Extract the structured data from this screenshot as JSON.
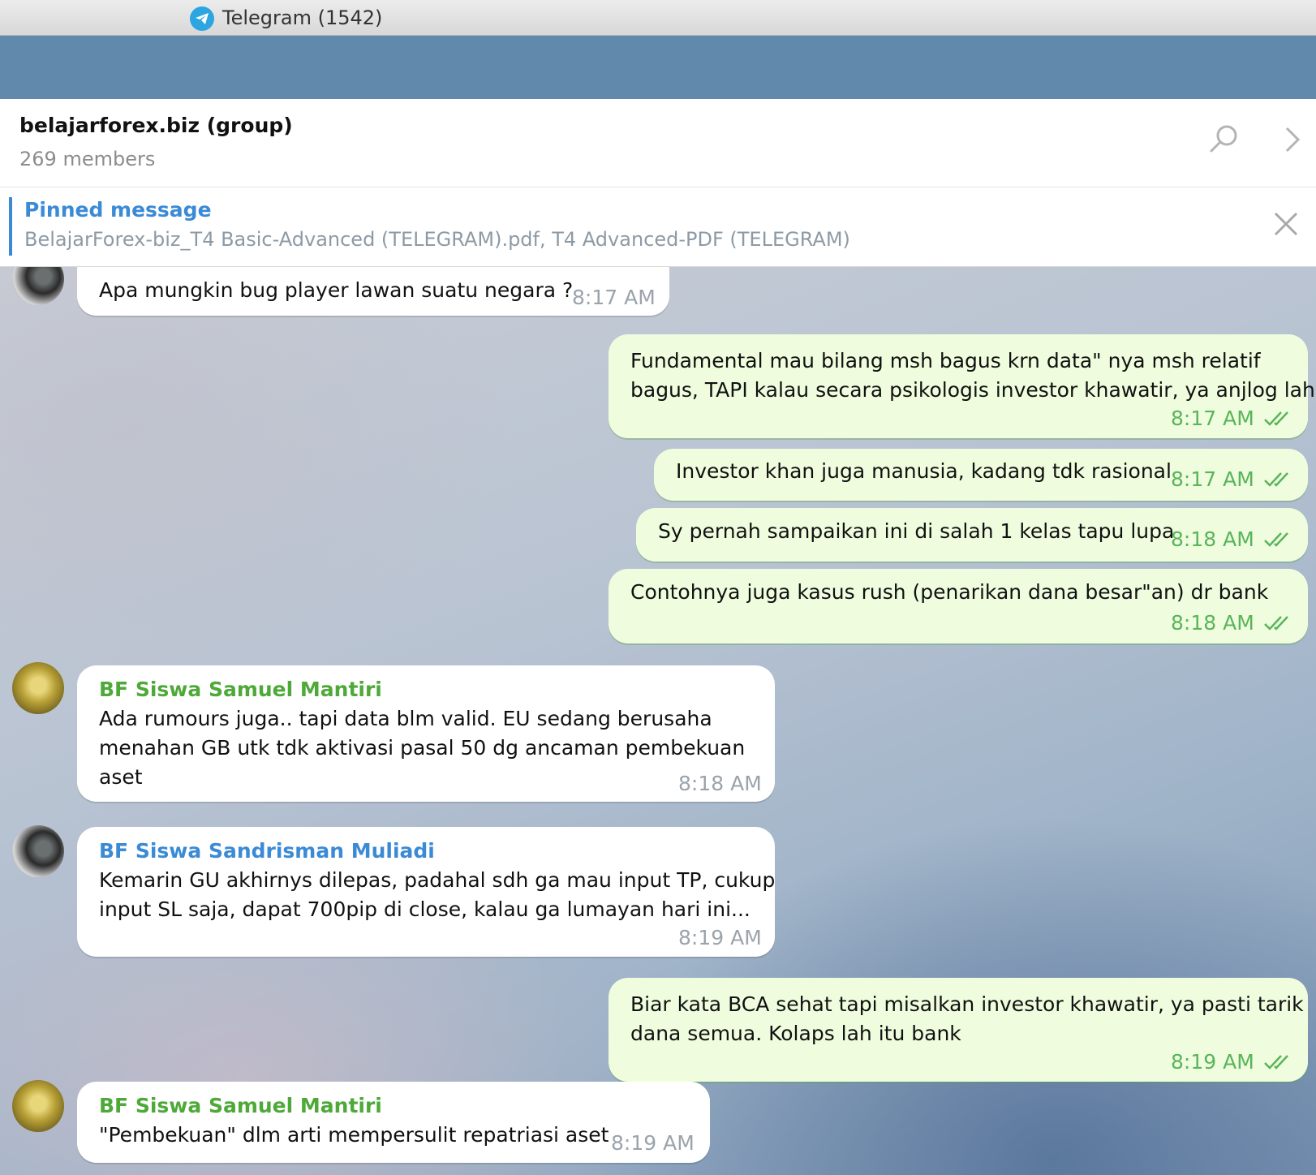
{
  "window": {
    "title": "Telegram (1542)"
  },
  "header": {
    "chat_title": "belajarforex.biz (group)",
    "members": "269 members"
  },
  "pinned": {
    "label": "Pinned message",
    "text": "BelajarForex-biz_T4 Basic-Advanced (TELEGRAM).pdf, T4 Advanced-PDF (TELEGRAM)"
  },
  "messages": [
    {
      "direction": "in",
      "sender": "",
      "lines": [
        "Apa mungkin bug player lawan suatu negara ?"
      ],
      "time": "8:17 AM"
    },
    {
      "direction": "out",
      "lines": [
        "Fundamental mau bilang msh bagus krn data\" nya msh relatif",
        "bagus, TAPI kalau secara psikologis investor khawatir, ya anjlog lah"
      ],
      "time": "8:17 AM"
    },
    {
      "direction": "out",
      "lines": [
        "Investor khan juga manusia, kadang tdk rasional"
      ],
      "time": "8:17 AM"
    },
    {
      "direction": "out",
      "lines": [
        "Sy pernah sampaikan ini di salah 1 kelas tapu lupa"
      ],
      "time": "8:18 AM"
    },
    {
      "direction": "out",
      "lines": [
        "Contohnya juga kasus rush (penarikan dana besar\"an) dr bank"
      ],
      "time": "8:18 AM"
    },
    {
      "direction": "in",
      "sender": "BF Siswa Samuel Mantiri",
      "sender_color": "#4ea938",
      "lines": [
        "Ada rumours juga.. tapi data blm valid. EU sedang berusaha",
        "menahan GB utk tdk aktivasi pasal 50 dg ancaman pembekuan",
        "aset"
      ],
      "time": "8:18 AM"
    },
    {
      "direction": "in",
      "sender": "BF Siswa Sandrisman Muliadi",
      "sender_color": "#3a8ad6",
      "lines": [
        "Kemarin GU akhirnys dilepas, padahal sdh ga mau input TP, cukup",
        "input SL saja, dapat 700pip di close, kalau ga lumayan hari ini..."
      ],
      "time": "8:19 AM"
    },
    {
      "direction": "out",
      "lines": [
        "Biar kata BCA sehat tapi misalkan investor khawatir, ya pasti tarik",
        "dana semua. Kolaps lah itu bank"
      ],
      "time": "8:19 AM"
    },
    {
      "direction": "in",
      "sender": "BF Siswa Samuel Mantiri",
      "sender_color": "#4ea938",
      "lines": [
        "\"Pembekuan\" dlm arti mempersulit repatriasi aset"
      ],
      "time": "8:19 AM"
    }
  ]
}
